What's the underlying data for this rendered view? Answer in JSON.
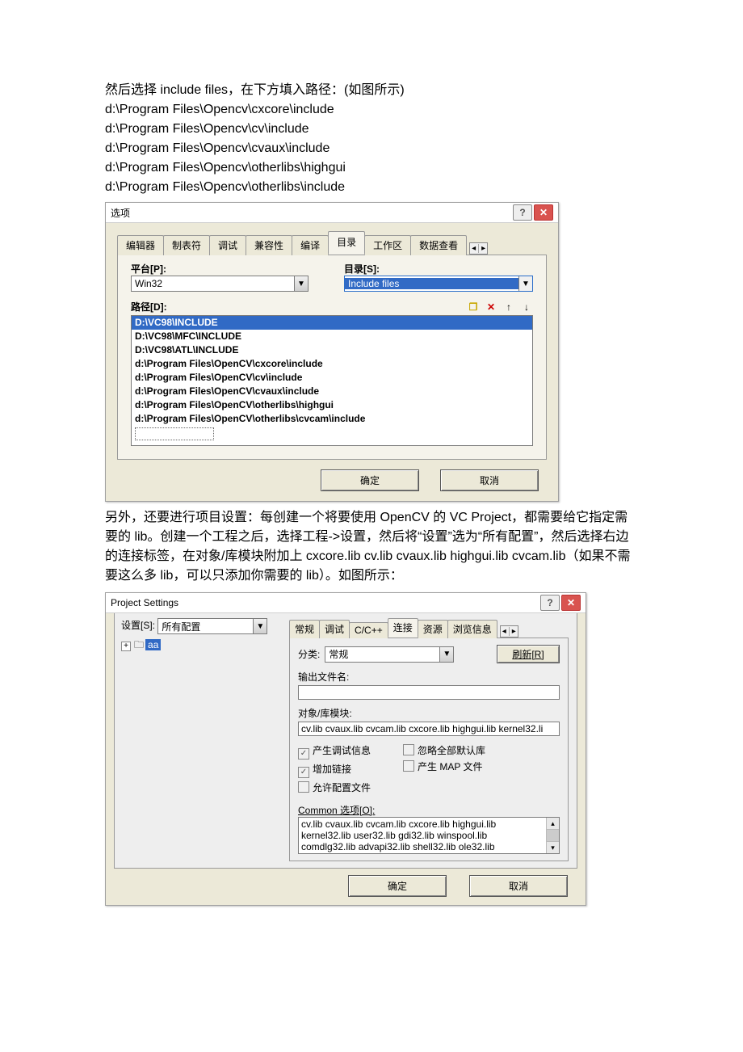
{
  "intro": {
    "l0": "然后选择 include files，在下方填入路径：(如图所示)",
    "l1": "d:\\Program Files\\Opencv\\cxcore\\include",
    "l2": "d:\\Program Files\\Opencv\\cv\\include",
    "l3": "d:\\Program Files\\Opencv\\cvaux\\include",
    "l4": "d:\\Program Files\\Opencv\\otherlibs\\highgui",
    "l5": "d:\\Program Files\\Opencv\\otherlibs\\include"
  },
  "dlg1": {
    "title": "选项",
    "tabs": {
      "t0": "编辑器",
      "t1": "制表符",
      "t2": "调试",
      "t3": "兼容性",
      "t4": "编译",
      "t5": "目录",
      "t6": "工作区",
      "t7": "数据查看"
    },
    "labels": {
      "platform": "平台[P]:",
      "show": "目录[S]:",
      "paths": "路径[D]:"
    },
    "platform": "Win32",
    "show": "Include files",
    "paths": [
      "D:\\VC98\\INCLUDE",
      "D:\\VC98\\MFC\\INCLUDE",
      "D:\\VC98\\ATL\\INCLUDE",
      "d:\\Program Files\\OpenCV\\cxcore\\include",
      "d:\\Program Files\\OpenCV\\cv\\include",
      "d:\\Program Files\\OpenCV\\cvaux\\include",
      "d:\\Program Files\\OpenCV\\otherlibs\\highgui",
      "d:\\Program Files\\OpenCV\\otherlibs\\cvcam\\include"
    ],
    "buttons": {
      "ok": "确定",
      "cancel": "取消"
    }
  },
  "mid": "另外，还要进行项目设置：每创建一个将要使用 OpenCV 的 VC Project，都需要给它指定需要的 lib。创建一个工程之后，选择工程->设置，然后将“设置”选为“所有配置”，然后选择右边的连接标签，在对象/库模块附加上 cxcore.lib cv.lib cvaux.lib highgui.lib cvcam.lib（如果不需要这么多 lib，可以只添加你需要的 lib）。如图所示：",
  "dlg2": {
    "title": "Project Settings",
    "settings_label": "设置[S]:",
    "settings_value": "所有配置",
    "tree_item": "aa",
    "tabs": {
      "t0": "常规",
      "t1": "调试",
      "t2": "C/C++",
      "t3": "连接",
      "t4": "资源",
      "t5": "浏览信息"
    },
    "cat_label": "分类:",
    "cat_value": "常规",
    "refresh": "刷新[R]",
    "outname_label": "输出文件名:",
    "outname": "",
    "mods_label": "对象/库模块:",
    "mods": "cv.lib cvaux.lib cvcam.lib cxcore.lib highgui.lib kernel32.li",
    "cb": {
      "debug": "产生调试信息",
      "ignore": "忽略全部默认库",
      "inc": "增加链接",
      "map": "产生 MAP 文件",
      "cfg": "允许配置文件"
    },
    "common_label": "Common 选项[O]:",
    "common_lines": [
      "cv.lib cvaux.lib cvcam.lib cxcore.lib highgui.lib",
      "kernel32.lib user32.lib gdi32.lib winspool.lib",
      "comdlg32.lib advapi32.lib shell32.lib ole32.lib"
    ],
    "buttons": {
      "ok": "确定",
      "cancel": "取消"
    }
  }
}
